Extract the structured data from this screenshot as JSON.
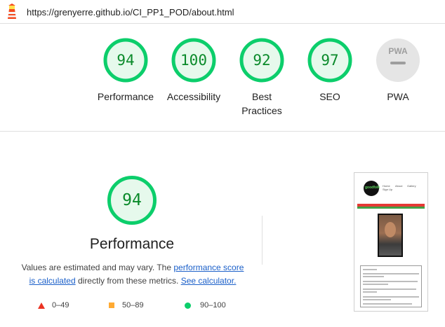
{
  "url_bar": {
    "url": "https://grenyerre.github.io/CI_PP1_POD/about.html"
  },
  "categories": [
    {
      "label": "Performance",
      "score": 94
    },
    {
      "label": "Accessibility",
      "score": 100
    },
    {
      "label": "Best Practices",
      "label_line1": "Best",
      "label_line2": "Practices",
      "score": 92
    },
    {
      "label": "SEO",
      "score": 97
    },
    {
      "label": "PWA",
      "badge": "PWA"
    }
  ],
  "performance_section": {
    "score": 94,
    "title": "Performance",
    "desc_1": "Values are estimated and may vary. The ",
    "link_score": "performance score",
    "link_calc": "is calculated",
    "desc_2": " directly from these metrics. ",
    "link_see": "See calculator."
  },
  "legend": [
    {
      "range": "0–49",
      "color": "#eb3323"
    },
    {
      "range": "50–89",
      "color": "#ffaa33"
    },
    {
      "range": "90–100",
      "color": "#0cce6b"
    }
  ],
  "colors": {
    "pass_ring": "#0cce6b",
    "pass_text": "#0a8a2a",
    "ring_bg": "#e6f9ec",
    "pwa_gray": "#9e9e9e"
  },
  "thumbnail": {
    "logo_text": "goodfolk",
    "nav_1": "Home",
    "nav_2": "About",
    "nav_3": "Gallery",
    "nav_4": "Sign Up"
  }
}
